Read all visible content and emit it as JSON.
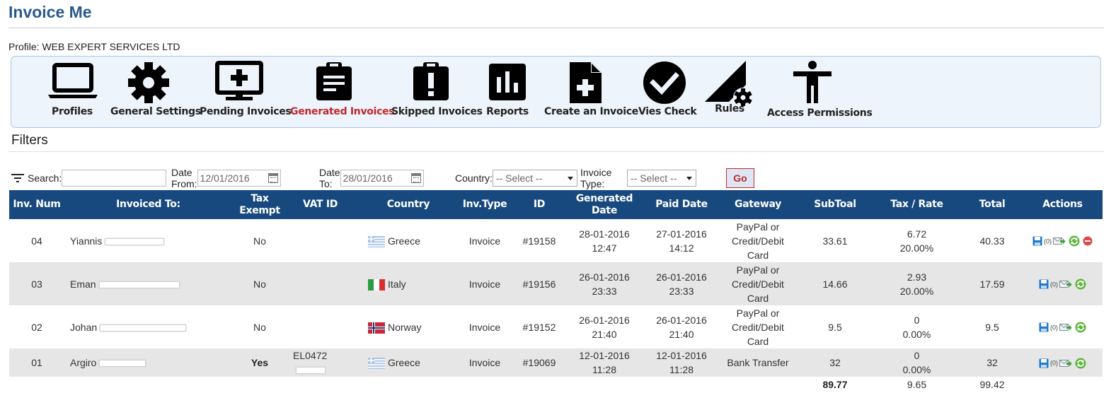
{
  "app": {
    "title": "Invoice Me"
  },
  "profile": {
    "label": "Profile:",
    "value": "WEB EXPERT SERVICES LTD"
  },
  "toolbar": {
    "items": [
      {
        "label": "Profiles",
        "icon": "laptop-icon"
      },
      {
        "label": "General Settings",
        "icon": "gear-icon"
      },
      {
        "label": "Pending Invoices",
        "icon": "monitor-plus-icon"
      },
      {
        "label": "Generated Invoices",
        "icon": "clipboard-list-icon",
        "active": true
      },
      {
        "label": "Skipped Invoices",
        "icon": "clipboard-alert-icon"
      },
      {
        "label": "Reports",
        "icon": "bar-chart-icon"
      },
      {
        "label": "Create an Invoice",
        "icon": "file-plus-icon"
      },
      {
        "label": "Vies Check",
        "icon": "check-circle-icon"
      },
      {
        "label": "Rules",
        "icon": "ruler-gear-icon"
      },
      {
        "label": "Access Permissions",
        "icon": "person-icon"
      }
    ],
    "active_color": "#c0282d"
  },
  "filters": {
    "title": "Filters",
    "search_label": "Search:",
    "search_value": "",
    "date_from_label": "Date From:",
    "date_from_value": "12/01/2016",
    "date_to_label": "Date To:",
    "date_to_value": "28/01/2016",
    "country_label": "Country:",
    "country_value": "-- Select --",
    "invoice_type_label": "Invoice Type:",
    "invoice_type_value": "-- Select --",
    "go_label": "Go"
  },
  "table": {
    "header_color": "#17497f",
    "headers": {
      "inv_num": "Inv. Num",
      "invoiced_to": "Invoiced To:",
      "tax_exempt_1": "Tax",
      "tax_exempt_2": "Exempt",
      "vat_id": "VAT ID",
      "country": "Country",
      "inv_type": "Inv.Type",
      "id": "ID",
      "generated_1": "Generated",
      "generated_2": "Date",
      "paid_date": "Paid Date",
      "gateway": "Gateway",
      "subtotal": "SubToal",
      "tax_rate": "Tax / Rate",
      "total": "Total",
      "actions": "Actions"
    },
    "rows": [
      {
        "inv_num": "04",
        "name": "Yiannis",
        "tax_exempt": "No",
        "vat_id": "",
        "country": "Greece",
        "flag": "greece",
        "inv_type": "Invoice",
        "id": "#19158",
        "gen_date": "28-01-2016",
        "gen_time": "12:47",
        "paid_date": "27-01-2016",
        "paid_time": "14:12",
        "gw1": "PayPal or",
        "gw2": "Credit/Debit",
        "gw3": "Card",
        "subtotal": "33.61",
        "tax": "6.72",
        "rate": "20.00%",
        "total": "40.33",
        "count": "(0)",
        "deletable": true
      },
      {
        "inv_num": "03",
        "name": "Eman",
        "tax_exempt": "No",
        "vat_id": "",
        "country": "Italy",
        "flag": "italy",
        "inv_type": "Invoice",
        "id": "#19156",
        "gen_date": "26-01-2016",
        "gen_time": "23:33",
        "paid_date": "26-01-2016",
        "paid_time": "23:33",
        "gw1": "PayPal or",
        "gw2": "Credit/Debit",
        "gw3": "Card",
        "subtotal": "14.66",
        "tax": "2.93",
        "rate": "20.00%",
        "total": "17.59",
        "count": "(0)"
      },
      {
        "inv_num": "02",
        "name": "Johan",
        "tax_exempt": "No",
        "vat_id": "",
        "country": "Norway",
        "flag": "norway",
        "inv_type": "Invoice",
        "id": "#19152",
        "gen_date": "26-01-2016",
        "gen_time": "21:40",
        "paid_date": "26-01-2016",
        "paid_time": "21:40",
        "gw1": "PayPal or",
        "gw2": "Credit/Debit",
        "gw3": "Card",
        "subtotal": "9.5",
        "tax": "0",
        "rate": "0.00%",
        "total": "9.5",
        "count": "(0)"
      },
      {
        "inv_num": "01",
        "name": "Argiro",
        "tax_exempt": "Yes",
        "vat_id": "EL0472",
        "country": "Greece",
        "flag": "greece",
        "inv_type": "Invoice",
        "id": "#19069",
        "gen_date": "12-01-2016",
        "gen_time": "11:28",
        "paid_date": "12-01-2016",
        "paid_time": "11:28",
        "gw1": "Bank Transfer",
        "gw2": "",
        "gw3": "",
        "subtotal": "32",
        "tax": "0",
        "rate": "0.00%",
        "total": "32",
        "count": "(0)"
      }
    ],
    "totals": {
      "subtotal": "89.77",
      "tax": "9.65",
      "total": "99.42"
    }
  }
}
